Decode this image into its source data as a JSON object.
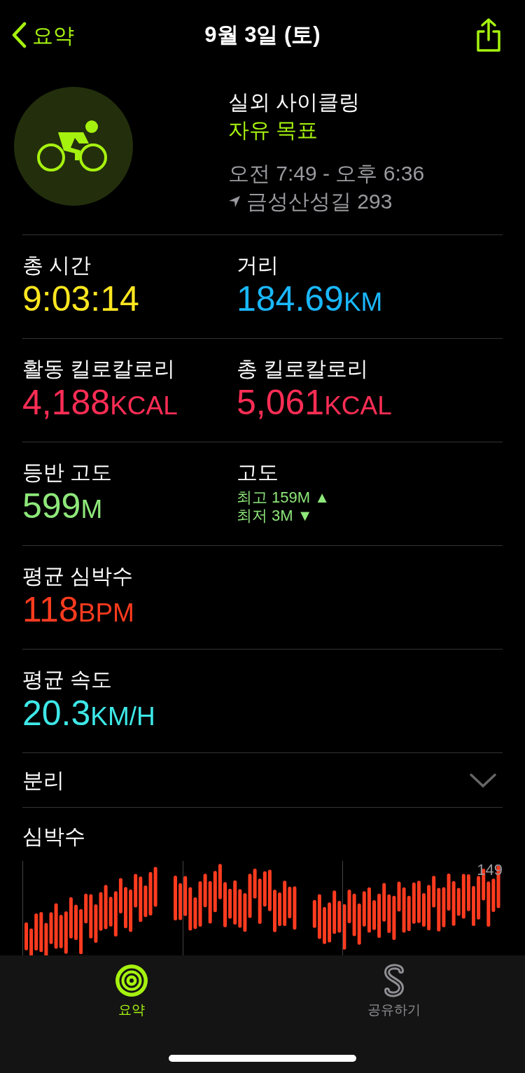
{
  "nav": {
    "back_label": "요약",
    "title": "9월 3일 (토)"
  },
  "workout": {
    "name": "실외 사이클링",
    "goal": "자유 목표",
    "time_range": "오전 7:49 - 오후 6:36",
    "location": "금성산성길 293"
  },
  "metrics": [
    [
      {
        "kind": "value",
        "label": "총 시간",
        "value": "9:03:14",
        "color": "#ffe620"
      },
      {
        "kind": "value",
        "label": "거리",
        "value": "184.69",
        "unit": "KM",
        "color": "#1ab8ff"
      }
    ],
    [
      {
        "kind": "value",
        "label": "활동 킬로칼로리",
        "value": "4,188",
        "unit": "KCAL",
        "color": "#ff2d55"
      },
      {
        "kind": "value",
        "label": "총 킬로칼로리",
        "value": "5,061",
        "unit": "KCAL",
        "color": "#ff2d55"
      }
    ],
    [
      {
        "kind": "value",
        "label": "등반 고도",
        "value": "599",
        "unit": "M",
        "color": "#8ee87a"
      },
      {
        "kind": "range",
        "label": "고도",
        "high": "최고 159M ▲",
        "low": "최저 3M ▼",
        "color": "#8ee87a"
      }
    ],
    [
      {
        "kind": "value",
        "label": "평균 심박수",
        "value": "118",
        "unit": "BPM",
        "color": "#ff3b1f"
      }
    ],
    [
      {
        "kind": "value",
        "label": "평균 속도",
        "value": "20.3",
        "unit": "KM/H",
        "color": "#3ee8e8"
      }
    ]
  ],
  "splits": {
    "label": "분리",
    "expanded": false
  },
  "heart_chart": {
    "title": "심박수",
    "max_label": "149"
  },
  "tabs": [
    {
      "label": "요약",
      "selected": true
    },
    {
      "label": "공유하기",
      "selected": false
    }
  ]
}
